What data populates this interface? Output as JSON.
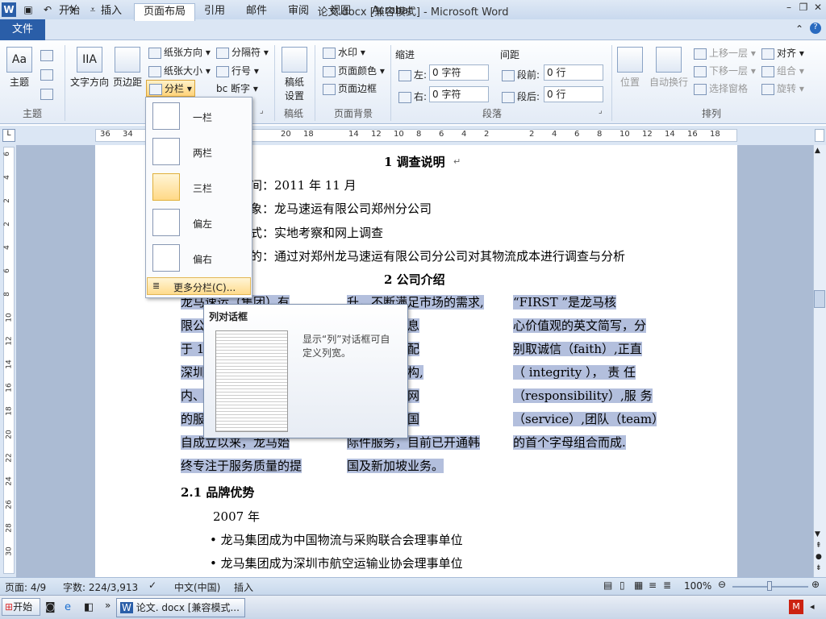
{
  "window": {
    "title": "论文.docx [兼容模式] - Microsoft Word"
  },
  "tabs": [
    "开始",
    "插入",
    "页面布局",
    "引用",
    "邮件",
    "审阅",
    "视图",
    "Acrobat"
  ],
  "file_tab": "文件",
  "ribbon": {
    "theme": {
      "themes": "主题",
      "group": "主题"
    },
    "page_setup": {
      "text_direction": "文字方向",
      "margins": "页边距",
      "orientation": "纸张方向",
      "size": "纸张大小",
      "columns": "分栏",
      "breaks": "分隔符",
      "line_numbers": "行号",
      "hyphenation": "断字",
      "group": "页"
    },
    "draft": {
      "settings": "稿纸\n设置",
      "label1": "稿纸",
      "label2": "设置",
      "group": "稿纸"
    },
    "background": {
      "watermark": "水印",
      "page_color": "页面颜色",
      "page_border": "页面边框",
      "group": "页面背景"
    },
    "paragraph": {
      "indent": "缩进",
      "spacing": "间距",
      "left": "左:",
      "right": "右:",
      "before": "段前:",
      "after": "段后:",
      "left_val": "0 字符",
      "right_val": "0 字符",
      "before_val": "0 行",
      "after_val": "0 行",
      "group": "段落"
    },
    "arrange": {
      "position": "位置",
      "wrap": "自动换行",
      "forward": "上移一层",
      "backward": "下移一层",
      "selection": "选择窗格",
      "align": "对齐",
      "group_btn": "组合",
      "rotate": "旋转",
      "group": "排列"
    }
  },
  "columns_menu": {
    "items": [
      "一栏",
      "两栏",
      "三栏",
      "偏左",
      "偏右"
    ],
    "more": "更多分栏(C)..."
  },
  "tooltip": {
    "title": "列对话框",
    "body_line1": "显示“列”对话框可自",
    "body_line2": "定义列宽。"
  },
  "ruler": {
    "h": [
      "36",
      "34",
      "20",
      "18",
      "14",
      "12",
      "10",
      "8",
      "6",
      "4",
      "2",
      "2",
      "4",
      "6",
      "8",
      "10",
      "12",
      "14",
      "16",
      "18"
    ],
    "v": [
      "6",
      "4",
      "2",
      "2",
      "4",
      "6",
      "8",
      "10",
      "12",
      "14",
      "16",
      "18",
      "20",
      "22",
      "24",
      "26",
      "28",
      "30"
    ]
  },
  "document": {
    "heading1": "1  调查说明",
    "line_time": "间：2011 年 11 月",
    "line_target": "象：龙马速运有限公司郑州分公司",
    "line_method": "式：实地考察和网上调查",
    "line_purpose": "的：通过对郑州龙马速运有限公司分公司对其物流成本进行调查与分析",
    "heading2": "2  公司介绍",
    "col1": [
      "龙马速运（集团）有",
      "限公",
      "于 1",
      "深圳",
      "内、",
      "的服",
      "    自成立以来，龙马始",
      "终专注于服务质量的提"
    ],
    "col2": [
      "升，不断满足市场的需求,",
      "了庞大的信息",
      "开发、物流配",
      "派等业务机构,",
      "户的全国性网",
      "也积极拓展国",
      "际件服务，目前已开通韩",
      "国及新加坡业务。"
    ],
    "col3": [
      "    “FIRST ”是龙马核",
      "心价值观的英文简写，分",
      "别取诚信（faith）,正直",
      "（ integrity ）， 责 任",
      "（responsibility）,服 务",
      "（service）,团队（team）",
      "的首个字母组合而成."
    ],
    "heading21": "2.1  品牌优势",
    "year": "2007 年",
    "bullet1": "龙马集团成为中国物流与采购联合会理事单位",
    "bullet2": "龙马集团成为深圳市航空运输业协会理事单位"
  },
  "status": {
    "page": "页面: 4/9",
    "words": "字数: 224/3,913",
    "lang": "中文(中国)",
    "mode": "插入",
    "zoom": "100%"
  },
  "taskbar": {
    "start": "开始",
    "task": "论文. docx [兼容模式..."
  }
}
